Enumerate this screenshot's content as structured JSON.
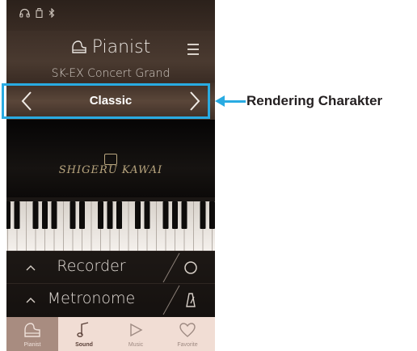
{
  "status_bar": {
    "icons": [
      "headphones-icon",
      "usb-icon",
      "bluetooth-icon"
    ]
  },
  "header": {
    "title": "Pianist",
    "subtitle": "SK-EX Concert Grand",
    "menu_icon": "menu-icon"
  },
  "rendering": {
    "value": "Classic",
    "prev_icon": "chevron-left-icon",
    "next_icon": "chevron-right-icon"
  },
  "piano_logo": "SHIGERU KAWAI",
  "controls": [
    {
      "label": "Recorder",
      "icon": "record-icon"
    },
    {
      "label": "Metronome",
      "icon": "metronome-icon"
    }
  ],
  "tabs": [
    {
      "label": "Pianist",
      "icon": "pianist-icon",
      "active": true
    },
    {
      "label": "Sound",
      "icon": "music-note-icon",
      "active": false
    },
    {
      "label": "Music",
      "icon": "play-icon",
      "active": false
    },
    {
      "label": "Favorite",
      "icon": "heart-icon",
      "active": false
    }
  ],
  "callout": {
    "label": "Rendering Charakter",
    "color": "#29abe2"
  }
}
